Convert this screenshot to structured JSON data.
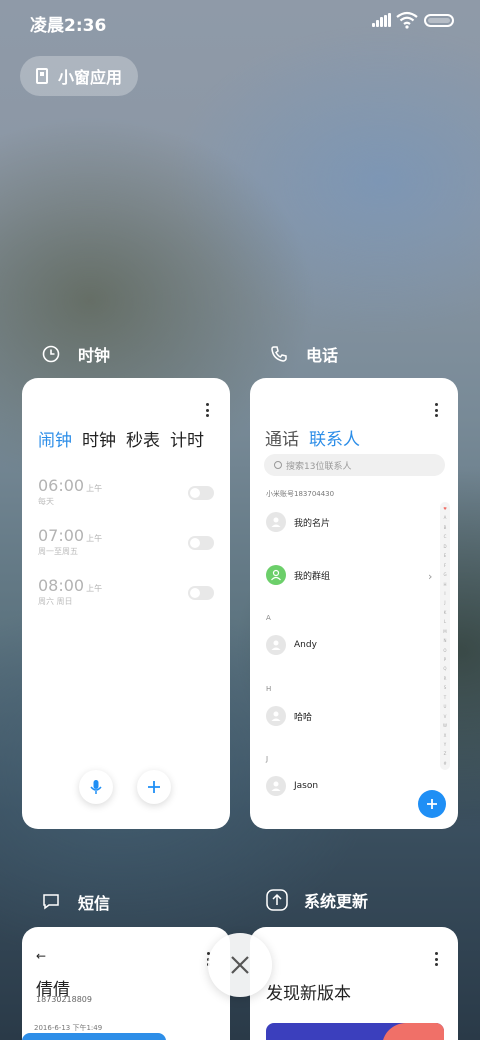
{
  "status_bar": {
    "time": "凌晨2:36",
    "signal_icon": "signal-icon",
    "wifi_icon": "wifi-icon",
    "battery_icon": "battery-icon"
  },
  "floating_window": {
    "label": "小窗应用",
    "icon": "window-icon"
  },
  "apps": {
    "clock": {
      "title": "时钟",
      "icon": "clock-icon",
      "tabs": [
        {
          "label": "闹钟",
          "active": true
        },
        {
          "label": "时钟",
          "active": false
        },
        {
          "label": "秒表",
          "active": false
        },
        {
          "label": "计时",
          "active": false
        }
      ],
      "alarms": [
        {
          "time": "06:00",
          "ampm": "上午",
          "repeat": "每天"
        },
        {
          "time": "07:00",
          "ampm": "上午",
          "repeat": "周一至周五"
        },
        {
          "time": "08:00",
          "ampm": "上午",
          "repeat": "周六 周日"
        }
      ]
    },
    "phone": {
      "title": "电话",
      "icon": "phone-icon",
      "tabs": [
        {
          "label": "通话",
          "active": false
        },
        {
          "label": "联系人",
          "active": true
        }
      ],
      "search_placeholder": "搜索13位联系人",
      "account": "小米账号183704430",
      "my_card": "我的名片",
      "my_groups": "我的群组",
      "sections": [
        {
          "letter": "A",
          "name": "Andy"
        },
        {
          "letter": "H",
          "name": "哈哈"
        },
        {
          "letter": "J",
          "name": "Jason"
        }
      ],
      "index_letters": [
        "♥",
        "A",
        "B",
        "C",
        "D",
        "E",
        "F",
        "G",
        "H",
        "I",
        "J",
        "K",
        "L",
        "M",
        "N",
        "O",
        "P",
        "Q",
        "R",
        "S",
        "T",
        "U",
        "V",
        "W",
        "X",
        "Y",
        "Z",
        "#"
      ]
    },
    "sms": {
      "title": "短信",
      "icon": "message-icon",
      "contact_name": "倩倩",
      "contact_number": "18730218809",
      "date": "2016-6-13 下午1:49"
    },
    "update": {
      "title": "系统更新",
      "icon": "update-icon",
      "heading": "发现新版本"
    }
  },
  "close_icon": "close-icon",
  "colors": {
    "accent": "#2d8ee8",
    "fab": "#1f8ff5",
    "group_avatar": "#6ccf6a"
  }
}
